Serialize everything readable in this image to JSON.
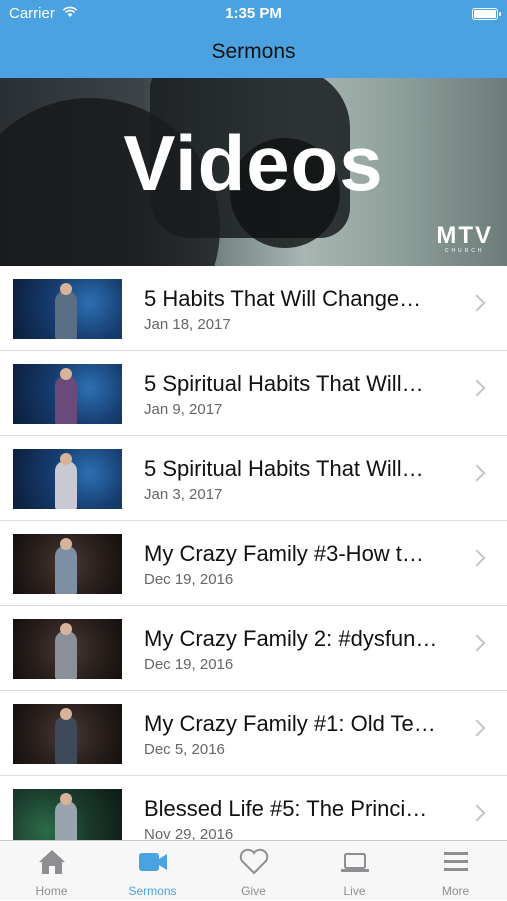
{
  "status_bar": {
    "carrier": "Carrier",
    "time": "1:35 PM"
  },
  "nav": {
    "title": "Sermons"
  },
  "hero": {
    "title": "Videos",
    "logo": "MTV",
    "logo_sub": "CHURCH"
  },
  "sermons": [
    {
      "title": "5 Habits That Will Change…",
      "date": "Jan 18, 2017"
    },
    {
      "title": "5 Spiritual Habits That Will…",
      "date": "Jan 9, 2017"
    },
    {
      "title": "5 Spiritual Habits That Will…",
      "date": "Jan 3, 2017"
    },
    {
      "title": "My Crazy Family #3-How t…",
      "date": "Dec 19, 2016"
    },
    {
      "title": "My Crazy Family 2: #dysfun…",
      "date": "Dec 19, 2016"
    },
    {
      "title": "My Crazy Family #1: Old Te…",
      "date": "Dec 5, 2016"
    },
    {
      "title": "Blessed Life #5: The Princi…",
      "date": "Nov 29, 2016"
    }
  ],
  "tabs": [
    {
      "label": "Home",
      "icon": "home-icon"
    },
    {
      "label": "Sermons",
      "icon": "video-camera-icon",
      "active": true
    },
    {
      "label": "Give",
      "icon": "heart-icon"
    },
    {
      "label": "Live",
      "icon": "laptop-icon"
    },
    {
      "label": "More",
      "icon": "menu-icon"
    }
  ],
  "colors": {
    "accent": "#4aa3e0",
    "tab_inactive": "#8e8e93"
  }
}
